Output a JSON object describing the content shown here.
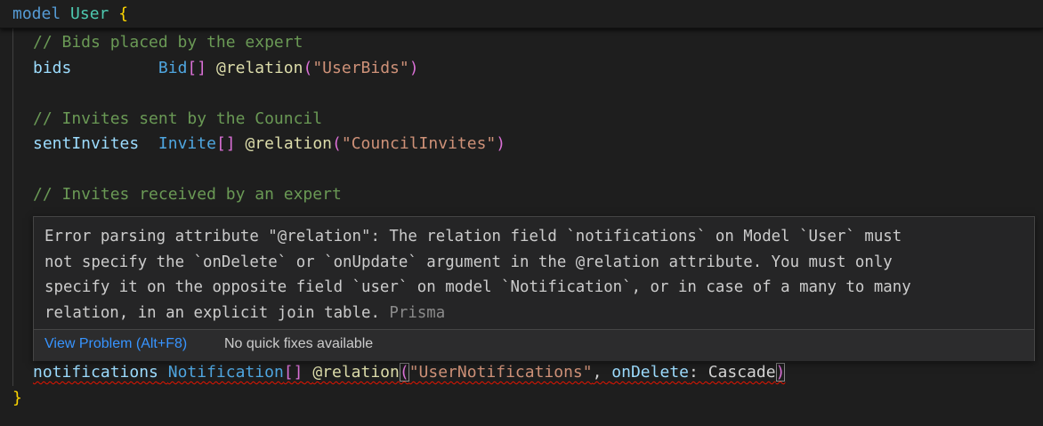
{
  "editor": {
    "header": {
      "keyword": "model",
      "name": "User",
      "open_brace": "{"
    },
    "lines": {
      "c1": "// Bids placed by the expert",
      "bids_field": "bids",
      "bids_type": "Bid",
      "bids_attr": "@relation",
      "bids_arg": "\"UserBids\"",
      "c2": "// Invites sent by the Council",
      "sent_field": "sentInvites",
      "sent_type": "Invite",
      "sent_attr": "@relation",
      "sent_arg": "\"CouncilInvites\"",
      "c3": "// Invites received by an expert",
      "notif_field": "notifications",
      "notif_type": "Notification",
      "notif_attr": "@relation",
      "notif_arg1": "\"UserNotifications\"",
      "notif_arg2_key": "onDelete",
      "notif_arg2_val": "Cascade",
      "close_brace": "}"
    }
  },
  "hover": {
    "message_lines": [
      "Error parsing attribute \"@relation\": The relation field `notifications` on Model `User` must",
      "not specify the `onDelete` or `onUpdate` argument in the @relation attribute. You must only",
      "specify it on the opposite field `user` on model `Notification`, or in case of a many to many",
      "relation, in an explicit join table. "
    ],
    "source": "Prisma",
    "view_problem": "View Problem (Alt+F8)",
    "no_fixes": "No quick fixes available"
  },
  "colors": {
    "background": "#1e1e1e",
    "keyword": "#569cd6",
    "type": "#4ec9b0",
    "comment": "#6a9955",
    "string": "#ce9178",
    "error": "#e51400",
    "link": "#3794ff"
  }
}
